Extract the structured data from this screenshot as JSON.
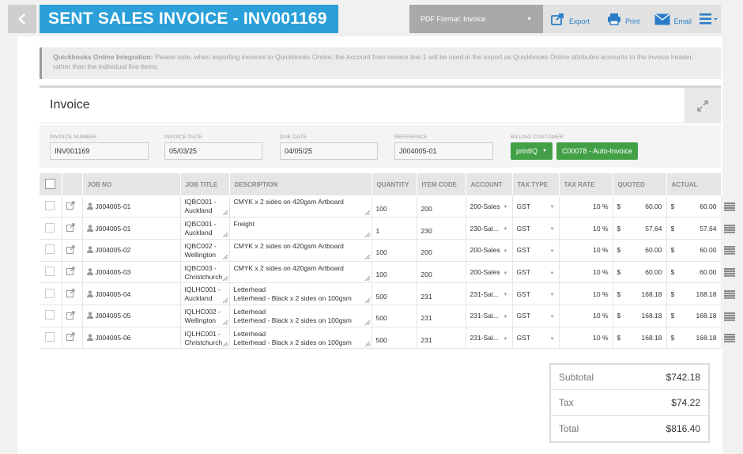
{
  "header": {
    "back_icon": "chevron-left-icon",
    "title": "SENT SALES INVOICE - INV001169",
    "pdf_format": "PDF Format: Invoice",
    "export_label": "Export",
    "print_label": "Print",
    "email_label": "Email",
    "accent_color": "#2a9fd8"
  },
  "notice": {
    "bold": "Quickbooks Online Integration:",
    "text": " Please note, when exporting invoices to Quickbooks Online, the Account from invoice line 1 will be used in the export as Quickbooks Online attributes accounts to the invoice header, rather than the individual line items."
  },
  "section": {
    "title": "Invoice"
  },
  "fields": {
    "invoice_number_label": "INVOICE NUMBER",
    "invoice_number": "INV001169",
    "invoice_date_label": "INVOICE DATE",
    "invoice_date": "05/03/25",
    "due_date_label": "DUE DATE",
    "due_date": "04/05/25",
    "reference_label": "REFERENCE",
    "reference": "J004005-01",
    "billing_customer_label": "BILLING CUSTOMER",
    "billing_customer_btn": "printIQ",
    "customer_code_btn": "C00078 - Auto-Invoice"
  },
  "table": {
    "headers": [
      "JOB NO",
      "JOB TITLE",
      "DESCRIPTION",
      "QUANTITY",
      "ITEM CODE",
      "ACCOUNT",
      "TAX TYPE",
      "TAX RATE",
      "QUOTED",
      "ACTUAL"
    ],
    "rows": [
      {
        "job_no": "J004005-01",
        "title1": "IQBC001 -",
        "title2": "Auckland",
        "desc1": "CMYK x 2 sides  on 420gsm Artboard",
        "desc2": "",
        "qty": "100",
        "item_code": "200",
        "account": "200-Sales",
        "tax_type": "GST",
        "tax_rate": "10",
        "quoted": "60.00",
        "actual": "60.00"
      },
      {
        "job_no": "J004005-01",
        "title1": "IQBC001 -",
        "title2": "Auckland",
        "desc1": "Freight",
        "desc2": "",
        "qty": "1",
        "item_code": "230",
        "account": "230-Sal...",
        "tax_type": "GST",
        "tax_rate": "10",
        "quoted": "57.64",
        "actual": "57.64"
      },
      {
        "job_no": "J004005-02",
        "title1": "IQBC002 -",
        "title2": "Wellington",
        "desc1": "CMYK x 2 sides  on 420gsm Artboard",
        "desc2": "",
        "qty": "100",
        "item_code": "200",
        "account": "200-Sales",
        "tax_type": "GST",
        "tax_rate": "10",
        "quoted": "60.00",
        "actual": "60.00"
      },
      {
        "job_no": "J004005-03",
        "title1": "IQBC003 -",
        "title2": "Christchurch",
        "desc1": "CMYK x 2 sides  on 420gsm Artboard",
        "desc2": "",
        "qty": "100",
        "item_code": "200",
        "account": "200-Sales",
        "tax_type": "GST",
        "tax_rate": "10",
        "quoted": "60.00",
        "actual": "60.00"
      },
      {
        "job_no": "J004005-04",
        "title1": "IQLHC001 -",
        "title2": "Auckland",
        "desc1": "Letterhead",
        "desc2": "Letterhead -  Black x 2 sides  on 100gsm",
        "qty": "500",
        "item_code": "231",
        "account": "231-Sal...",
        "tax_type": "GST",
        "tax_rate": "10",
        "quoted": "168.18",
        "actual": "168.18"
      },
      {
        "job_no": "J004005-05",
        "title1": "IQLHC002 -",
        "title2": "Wellington",
        "desc1": "Letterhead",
        "desc2": "Letterhead -  Black x 2 sides  on 100gsm",
        "qty": "500",
        "item_code": "231",
        "account": "231-Sal...",
        "tax_type": "GST",
        "tax_rate": "10",
        "quoted": "168.18",
        "actual": "168.18"
      },
      {
        "job_no": "J004005-06",
        "title1": "IQLHC001 -",
        "title2": "Christchurch",
        "desc1": "Letterhead",
        "desc2": "Letterhead -  Black x 2 sides  on 100gsm",
        "qty": "500",
        "item_code": "231",
        "account": "231-Sal...",
        "tax_type": "GST",
        "tax_rate": "10",
        "quoted": "168.18",
        "actual": "168.18"
      }
    ],
    "percent": "%",
    "currency": "$"
  },
  "totals": {
    "subtotal_label": "Subtotal",
    "subtotal": "$742.18",
    "tax_label": "Tax",
    "tax": "$74.22",
    "total_label": "Total",
    "total": "$816.40"
  }
}
